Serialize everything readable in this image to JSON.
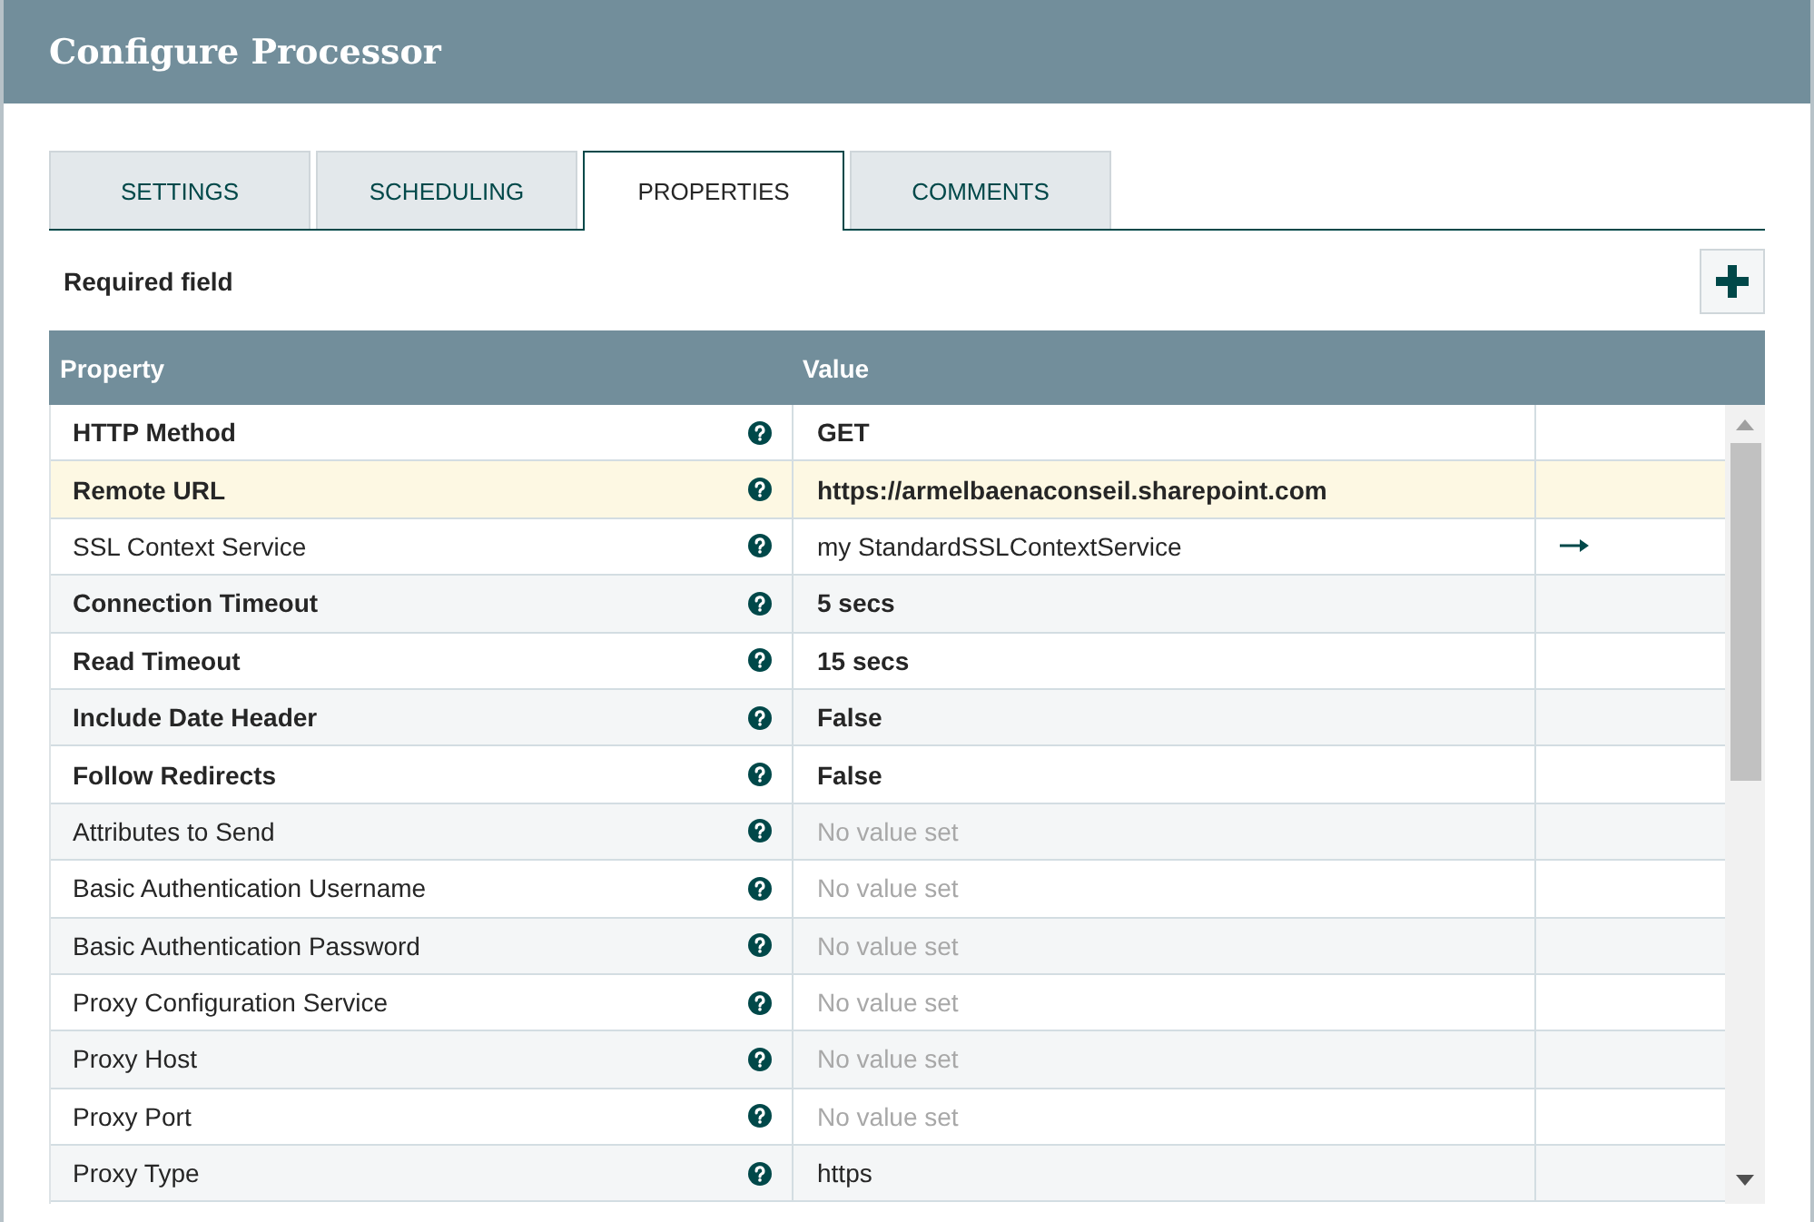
{
  "dialog": {
    "title": "Configure Processor"
  },
  "tabs": [
    {
      "label": "SETTINGS",
      "selected": false
    },
    {
      "label": "SCHEDULING",
      "selected": false
    },
    {
      "label": "PROPERTIES",
      "selected": true
    },
    {
      "label": "COMMENTS",
      "selected": false
    }
  ],
  "toolbar": {
    "required_label": "Required field"
  },
  "table": {
    "columns": [
      "Property",
      "Value"
    ],
    "rows": [
      {
        "property": "HTTP Method",
        "required": true,
        "value": "GET",
        "value_set": true,
        "selected": false,
        "go_to": false
      },
      {
        "property": "Remote URL",
        "required": true,
        "value": "https://armelbaenaconseil.sharepoint.com",
        "value_set": true,
        "selected": true,
        "go_to": false
      },
      {
        "property": "SSL Context Service",
        "required": false,
        "value": "my StandardSSLContextService",
        "value_set": true,
        "selected": false,
        "go_to": true
      },
      {
        "property": "Connection Timeout",
        "required": true,
        "value": "5 secs",
        "value_set": true,
        "selected": false,
        "go_to": false
      },
      {
        "property": "Read Timeout",
        "required": true,
        "value": "15 secs",
        "value_set": true,
        "selected": false,
        "go_to": false
      },
      {
        "property": "Include Date Header",
        "required": true,
        "value": "False",
        "value_set": true,
        "selected": false,
        "go_to": false
      },
      {
        "property": "Follow Redirects",
        "required": true,
        "value": "False",
        "value_set": true,
        "selected": false,
        "go_to": false
      },
      {
        "property": "Attributes to Send",
        "required": false,
        "value": "No value set",
        "value_set": false,
        "selected": false,
        "go_to": false
      },
      {
        "property": "Basic Authentication Username",
        "required": false,
        "value": "No value set",
        "value_set": false,
        "selected": false,
        "go_to": false
      },
      {
        "property": "Basic Authentication Password",
        "required": false,
        "value": "No value set",
        "value_set": false,
        "selected": false,
        "go_to": false
      },
      {
        "property": "Proxy Configuration Service",
        "required": false,
        "value": "No value set",
        "value_set": false,
        "selected": false,
        "go_to": false
      },
      {
        "property": "Proxy Host",
        "required": false,
        "value": "No value set",
        "value_set": false,
        "selected": false,
        "go_to": false
      },
      {
        "property": "Proxy Port",
        "required": false,
        "value": "No value set",
        "value_set": false,
        "selected": false,
        "go_to": false
      },
      {
        "property": "Proxy Type",
        "required": false,
        "value": "https",
        "value_set": true,
        "selected": false,
        "go_to": false
      }
    ]
  }
}
